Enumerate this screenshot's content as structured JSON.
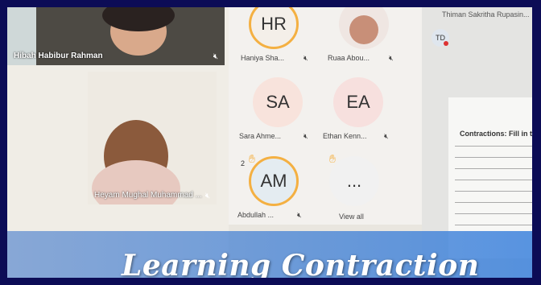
{
  "video_tiles": [
    {
      "name": "Hibah Habibur Rahman",
      "mic": "mic-muted-icon"
    },
    {
      "name": "Heyam Mughal Muhammad ...",
      "mic": "mic-muted-icon"
    }
  ],
  "participants": [
    {
      "initials": "HR",
      "name": "Haniya Sha...",
      "mic": "mic-muted-icon"
    },
    {
      "initials": "",
      "name": "Ruaa Abou...",
      "mic": "mic-muted-icon"
    },
    {
      "initials": "SA",
      "name": "Sara Ahme...",
      "mic": "mic-muted-icon"
    },
    {
      "initials": "EA",
      "name": "Ethan Kenn...",
      "mic": "mic-muted-icon"
    },
    {
      "initials": "AM",
      "name": "Abdullah ...",
      "mic": "mic-muted-icon",
      "raised_hand_count": "2"
    },
    {
      "initials": "...",
      "name": "View all"
    }
  ],
  "shared_screen": {
    "presenter": "Thiman Sakritha Rupasin...",
    "presenter_initials": "TD",
    "worksheet_title": "Contractions: Fill in the"
  },
  "banner": {
    "title": "Learning Contraction"
  },
  "colors": {
    "frame": "#0c0c56",
    "ring": "#f4b042",
    "banner": "#4a88d6"
  }
}
